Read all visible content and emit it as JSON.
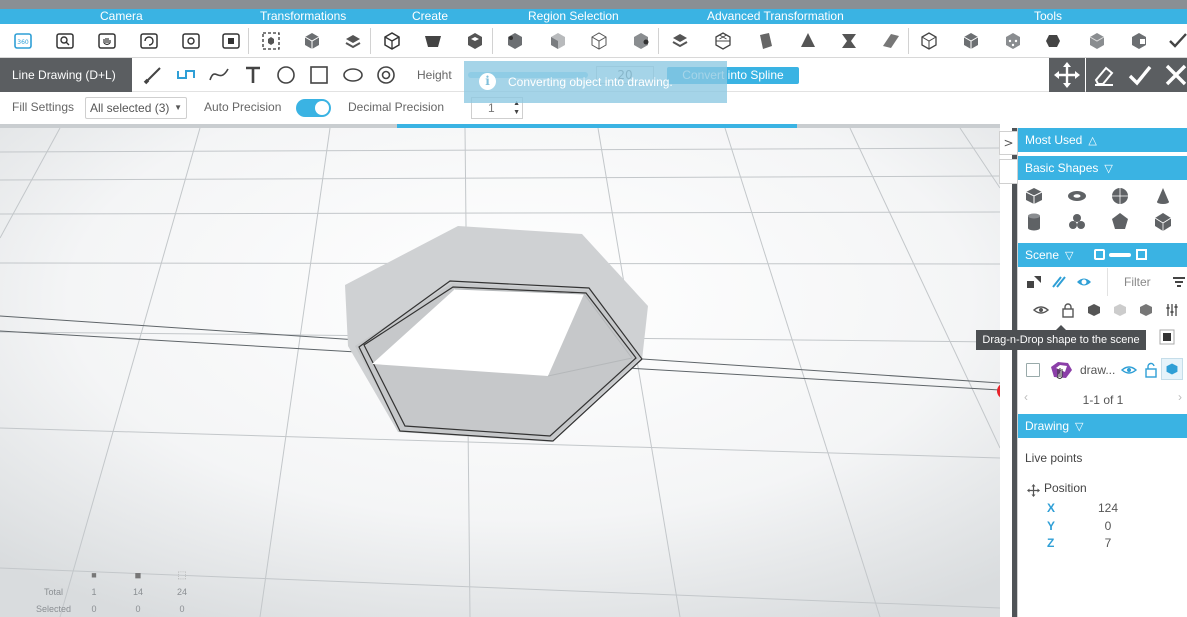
{
  "ribbon": {
    "tabs": [
      {
        "label": "Camera"
      },
      {
        "label": "Transformations"
      },
      {
        "label": "Create"
      },
      {
        "label": "Region Selection"
      },
      {
        "label": "Advanced Transformation"
      },
      {
        "label": "Tools"
      }
    ]
  },
  "toolbar": {
    "mode_label": "Line Drawing (D+L)",
    "height_label": "Height",
    "height_value": "20",
    "convert_label": "Convert into Spline"
  },
  "fill": {
    "fill_settings_label": "Fill Settings",
    "fill_selected": "All selected (3)",
    "auto_precision_label": "Auto Precision",
    "auto_precision_on": true,
    "decimal_precision_label": "Decimal Precision",
    "decimal_precision_value": "1"
  },
  "progress": 0.4,
  "toast": {
    "icon": "i",
    "message": "Converting object into drawing."
  },
  "stats": {
    "total_label": "Total",
    "selected_label": "Selected",
    "total": [
      "1",
      "14",
      "24"
    ],
    "selected": [
      "0",
      "0",
      "0"
    ]
  },
  "panel": {
    "collapse_glyph": ">",
    "most_used_label": "Most Used",
    "basic_shapes_label": "Basic Shapes",
    "scene_label": "Scene",
    "filter_placeholder": "Filter",
    "scene_item_name": "draw...",
    "pager_text": "1-1 of 1",
    "drawing_label": "Drawing",
    "live_points_label": "Live points",
    "position_label": "Position",
    "position": {
      "x_label": "X",
      "y_label": "Y",
      "z_label": "Z",
      "x": "124",
      "y": "0",
      "z": "7"
    }
  },
  "tooltip": "Drag-n-Drop shape to the scene",
  "colors": {
    "accent": "#3ab3e3",
    "dark": "#5b5e61",
    "tooltip": "#4c4f52"
  }
}
